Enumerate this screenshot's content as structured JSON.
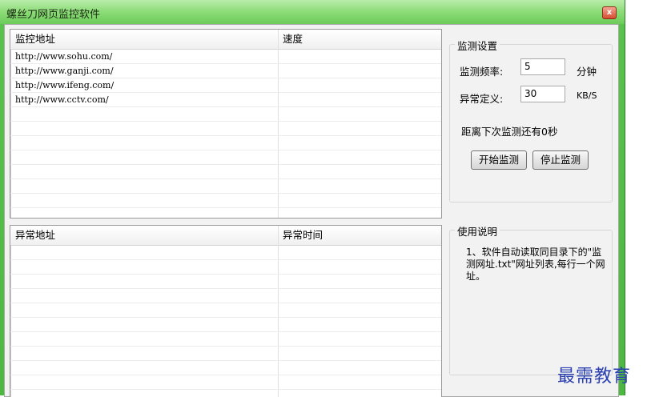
{
  "window": {
    "title": "螺丝刀网页监控软件",
    "close_glyph": "x"
  },
  "monitor_table": {
    "columns": [
      "监控地址",
      "速度"
    ],
    "rows": [
      {
        "url": "http://www.sohu.com/",
        "speed": ""
      },
      {
        "url": "http://www.ganji.com/",
        "speed": ""
      },
      {
        "url": "http://www.ifeng.com/",
        "speed": ""
      },
      {
        "url": "http://www.cctv.com/",
        "speed": ""
      }
    ]
  },
  "anomaly_table": {
    "columns": [
      "异常地址",
      "异常时间"
    ],
    "rows": []
  },
  "settings": {
    "group_label": "监测设置",
    "frequency_label": "监测频率:",
    "frequency_value": "5",
    "frequency_unit": "分钟",
    "anomaly_label": "异常定义:",
    "anomaly_value": "30",
    "anomaly_unit": "KB/S",
    "countdown_text": "距离下次监测还有0秒",
    "start_button": "开始监测",
    "stop_button": "停止监测"
  },
  "help": {
    "group_label": "使用说明",
    "text": "1、软件自动读取同目录下的\"监测网址.txt\"网址列表,每行一个网址。"
  },
  "watermark": "最需教育"
}
